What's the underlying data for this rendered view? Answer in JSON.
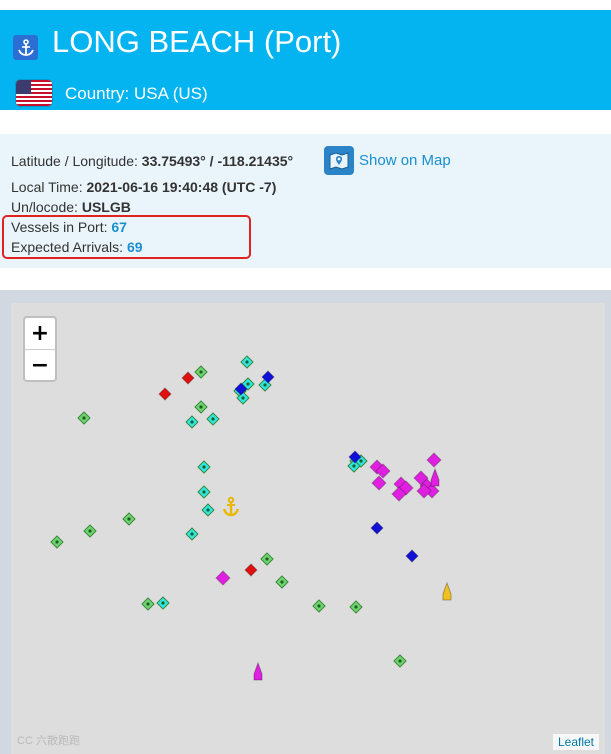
{
  "header": {
    "title": "LONG BEACH (Port)",
    "country": "Country: USA (US)",
    "anchor_icon": "anchor-icon",
    "flag_icon": "us-flag-icon"
  },
  "info": {
    "latlon_label": "Latitude / Longitude:",
    "latlon_value": "33.75493° / -118.21435°",
    "show_on_map": "Show on Map",
    "local_time_label": "Local Time:",
    "local_time_value": "2021-06-16 19:40:48 (UTC -7)",
    "unlocode_label": "Un/locode:",
    "unlocode_value": "USLGB",
    "vessels_label": "Vessels in Port:",
    "vessels_value": "67",
    "arrivals_label": "Expected Arrivals:",
    "arrivals_value": "69"
  },
  "map": {
    "zoom_in": "+",
    "zoom_out": "−",
    "attribution": "Leaflet",
    "watermark": "CC 六散跑跑",
    "colors": {
      "green": "#6fd46f",
      "cyan": "#2ee6e6",
      "red": "#e01010",
      "blue": "#1010d8",
      "magenta": "#e020e0",
      "yellow": "#f0c020"
    }
  }
}
